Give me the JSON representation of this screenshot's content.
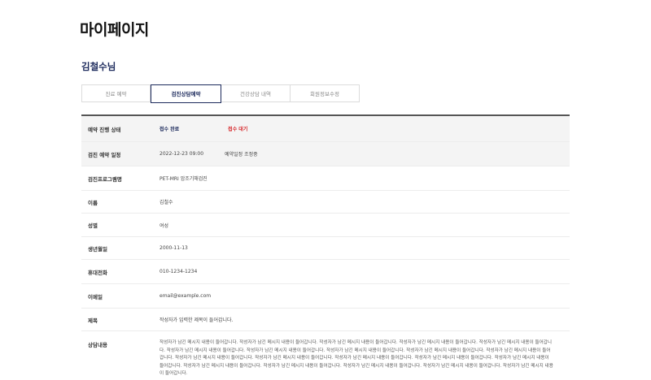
{
  "page": {
    "title": "마이페이지"
  },
  "user": {
    "name": "김철수님"
  },
  "tabs": [
    {
      "label": "진료 예약"
    },
    {
      "label": "검진상담예약"
    },
    {
      "label": "건강상담 내역"
    },
    {
      "label": "회원정보수정"
    }
  ],
  "active_tab_index": 1,
  "reservation": {
    "status": {
      "label": "예약 진행 상태",
      "done": "접수 완료",
      "waiting": "접수 대기"
    },
    "datetime": {
      "label": "검진 예약 일정",
      "value": "2022-12-23  09:00",
      "change_label": "예약일정 조정중"
    },
    "program": {
      "label": "검진프로그램명",
      "value": "PET-MRI 암조기해검진"
    },
    "name": {
      "label": "이름",
      "value": "김철수"
    },
    "gender": {
      "label": "성별",
      "value": "여성"
    },
    "birth": {
      "label": "생년월일",
      "value": "2000-11-13"
    },
    "phone": {
      "label": "휴대전화",
      "value": "010-1234-1234"
    },
    "email": {
      "label": "이메일",
      "value": "email@example.com"
    },
    "subject": {
      "label": "제목",
      "value": "작성자가 입력한 제목이 들어갑니다."
    },
    "content": {
      "label": "상담내용",
      "value": "작성자가 남긴 메시지 내용이 들어갑니다. 작성자가 남긴 메시지 내용이 들어갑니다. 작성자가 남긴 메시지 내용이 들어갑니다. 작성자가 남긴 메시지 내용이 들어갑니다. 작성자가 남긴 메시지 내용이 들어갑니다. 작성자가 남긴 메시지 내용이 들어갑니다. 작성자가 남긴 메시지 내용이 들어갑니다. 작성자가 남긴 메시지 내용이 들어갑니다. 작성자가 남긴 메시지 내용이 들어갑니다. 작성자가 남긴 메시지 내용이 들어갑니다. 작성자가 남긴 메시지 내용이 들어갑니다. 작성자가 남긴 메시지 내용이 들어갑니다. 작성자가 남긴 메시지 내용이 들어갑니다. 작성자가 남긴 메시지 내용이 들어갑니다. 작성자가 남긴 메시지 내용이 들어갑니다. 작성자가 남긴 메시지 내용이 들어갑니다. 작성자가 남긴 메시지 내용이 들어갑니다. 작성자가 남긴 메시지 내용이 들어갑니다. 작성자가 남긴 메시지 내용이 들어갑니다. 작성자가 남긴 메시지 내용이 들어갑니다."
    }
  },
  "colors": {
    "accent": "#1c2a5c",
    "waiting": "#d6262a",
    "row_shade": "#f4f4f4"
  }
}
